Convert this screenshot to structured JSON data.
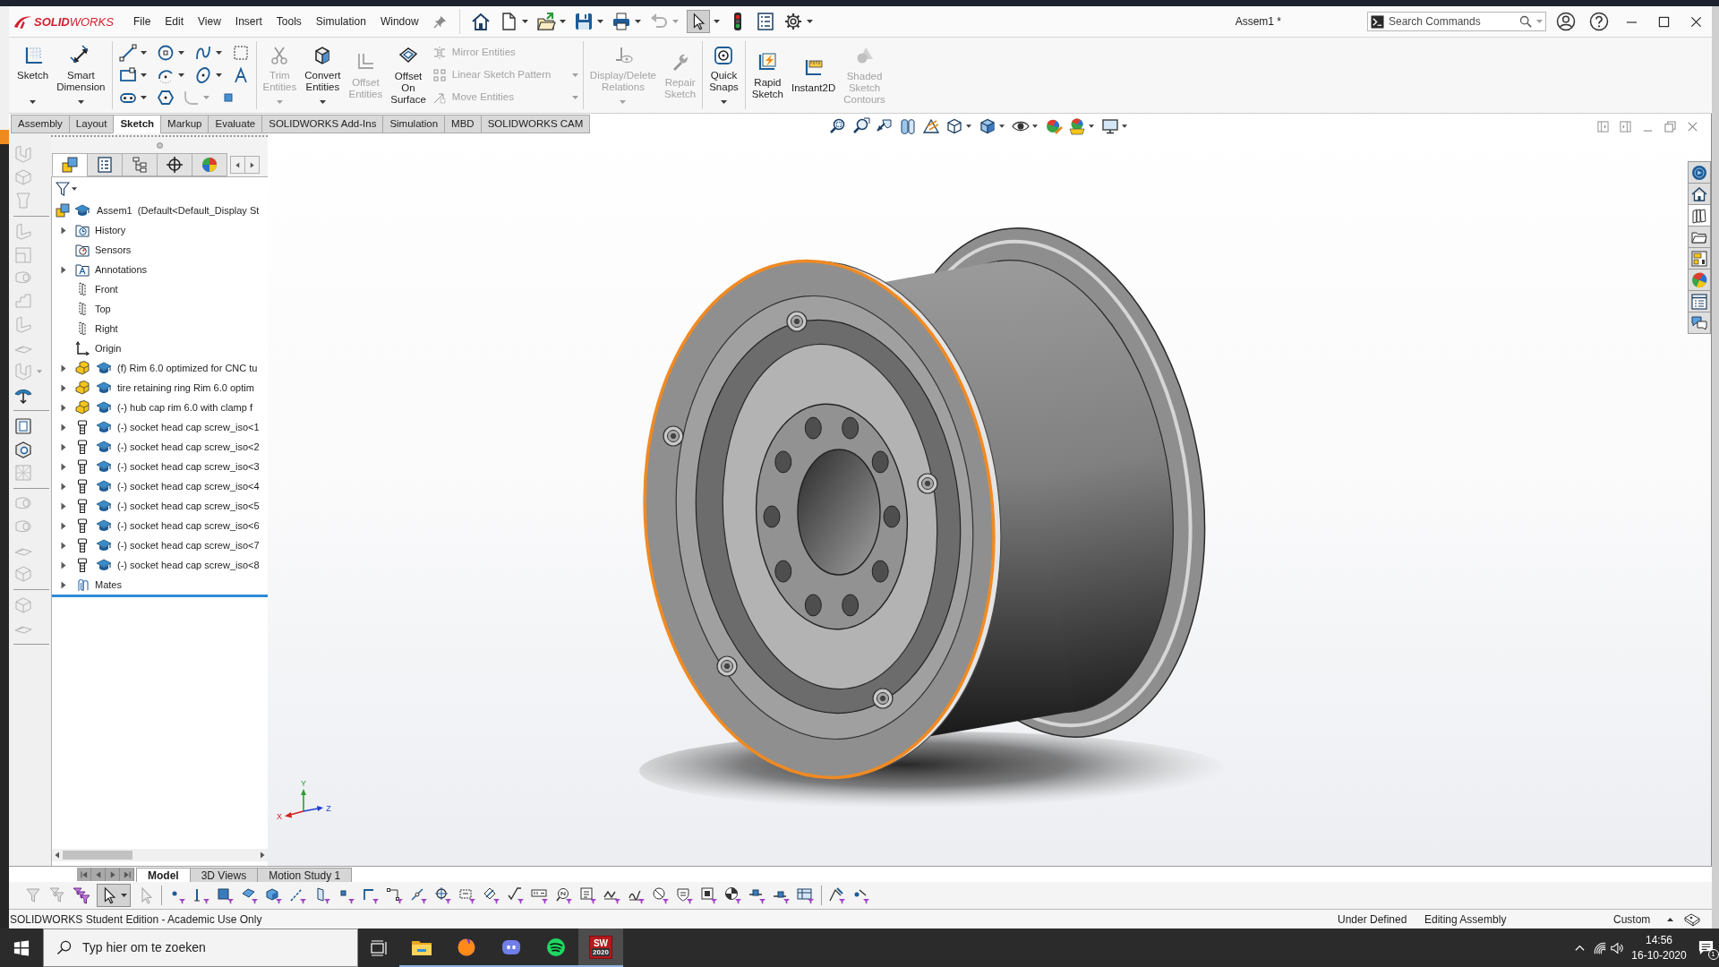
{
  "window": {
    "logo": "**SOLID**WORKS",
    "title": "Assem1 *"
  },
  "menu": [
    "File",
    "Edit",
    "View",
    "Insert",
    "Tools",
    "Simulation",
    "Window"
  ],
  "select_tool": {
    "selected": true
  },
  "search": {
    "placeholder": "Search Commands"
  },
  "ribbon": [
    [
      {
        "kind": "large",
        "label": "Sketch",
        "disabled": false,
        "dropdown": true
      },
      {
        "kind": "large",
        "label": "Smart\nDimension",
        "disabled": false,
        "dropdown": true
      }
    ],
    [
      {
        "kind": "tools"
      }
    ],
    [
      {
        "kind": "large",
        "label": "Trim\nEntities",
        "disabled": true,
        "dropdown": true
      },
      {
        "kind": "large",
        "label": "Convert\nEntities",
        "disabled": false,
        "dropdown": true
      },
      {
        "kind": "large",
        "label": "Offset\nEntities",
        "disabled": true,
        "dropdown": false
      },
      {
        "kind": "large",
        "label": "Offset\nOn\nSurface",
        "disabled": false,
        "dropdown": false
      },
      {
        "kind": "stack",
        "rows": [
          {
            "label": "Mirror Entities",
            "disabled": true,
            "dropdown": false
          },
          {
            "label": "Linear Sketch Pattern",
            "disabled": true,
            "dropdown": true
          },
          {
            "label": "Move Entities",
            "disabled": true,
            "dropdown": true
          }
        ]
      }
    ],
    [
      {
        "kind": "large",
        "label": "Display/Delete\nRelations",
        "disabled": true,
        "dropdown": true
      },
      {
        "kind": "large",
        "label": "Repair\nSketch",
        "disabled": true,
        "dropdown": false
      }
    ],
    [
      {
        "kind": "large",
        "label": "Quick\nSnaps",
        "disabled": false,
        "dropdown": true
      }
    ],
    [
      {
        "kind": "large",
        "label": "Rapid\nSketch",
        "disabled": false,
        "dropdown": false
      },
      {
        "kind": "large",
        "label": "Instant2D",
        "disabled": false,
        "dropdown": false
      },
      {
        "kind": "large",
        "label": "Shaded\nSketch\nContours",
        "disabled": true,
        "dropdown": false
      }
    ]
  ],
  "command_tabs": [
    {
      "label": "Assembly",
      "selected": false
    },
    {
      "label": "Layout",
      "selected": false
    },
    {
      "label": "Sketch",
      "selected": true
    },
    {
      "label": "Markup",
      "selected": false
    },
    {
      "label": "Evaluate",
      "selected": false
    },
    {
      "label": "SOLIDWORKS Add-Ins",
      "selected": false
    },
    {
      "label": "Simulation",
      "selected": false
    },
    {
      "label": "MBD",
      "selected": false
    },
    {
      "label": "SOLIDWORKS CAM",
      "selected": false
    }
  ],
  "feature_manager": {
    "tabs": [
      {
        "kind": "tree",
        "selected": true
      },
      {
        "kind": "properties",
        "selected": false
      },
      {
        "kind": "configurations",
        "selected": false
      },
      {
        "kind": "dimxpert",
        "selected": false
      },
      {
        "kind": "display",
        "selected": false
      }
    ],
    "tree": {
      "kind": "assembly",
      "label": "Assem1  (Default<Default_Display St",
      "children": [
        {
          "kind": "history",
          "label": "History",
          "expandable": true,
          "expanded": false
        },
        {
          "kind": "sensors",
          "label": "Sensors",
          "expandable": false,
          "expanded": false
        },
        {
          "kind": "annotations",
          "label": "Annotations",
          "expandable": true,
          "expanded": false
        },
        {
          "kind": "plane",
          "label": "Front",
          "expandable": false,
          "expanded": false
        },
        {
          "kind": "plane",
          "label": "Top",
          "expandable": false,
          "expanded": false
        },
        {
          "kind": "plane",
          "label": "Right",
          "expandable": false,
          "expanded": false
        },
        {
          "kind": "origin",
          "label": "Origin",
          "expandable": false,
          "expanded": false
        },
        {
          "kind": "part",
          "label": "(f) Rim 6.0 optimized for CNC tu",
          "expandable": true,
          "expanded": false
        },
        {
          "kind": "part",
          "label": "tire retaining ring Rim 6.0 optim",
          "expandable": true,
          "expanded": false
        },
        {
          "kind": "part",
          "label": "(-) hub cap rim 6.0 with clamp f",
          "expandable": true,
          "expanded": false
        },
        {
          "kind": "screw",
          "label": "(-) socket head cap screw_iso<1",
          "expandable": true,
          "expanded": false
        },
        {
          "kind": "screw",
          "label": "(-) socket head cap screw_iso<2",
          "expandable": true,
          "expanded": false
        },
        {
          "kind": "screw",
          "label": "(-) socket head cap screw_iso<3",
          "expandable": true,
          "expanded": false
        },
        {
          "kind": "screw",
          "label": "(-) socket head cap screw_iso<4",
          "expandable": true,
          "expanded": false
        },
        {
          "kind": "screw",
          "label": "(-) socket head cap screw_iso<5",
          "expandable": true,
          "expanded": false
        },
        {
          "kind": "screw",
          "label": "(-) socket head cap screw_iso<6",
          "expandable": true,
          "expanded": false
        },
        {
          "kind": "screw",
          "label": "(-) socket head cap screw_iso<7",
          "expandable": true,
          "expanded": false
        },
        {
          "kind": "screw",
          "label": "(-) socket head cap screw_iso<8",
          "expandable": true,
          "expanded": false
        },
        {
          "kind": "mates",
          "label": "Mates",
          "expandable": true,
          "expanded": false
        }
      ]
    }
  },
  "viewport": {
    "rim_selected": true,
    "triad": {
      "x": "X",
      "y": "Y",
      "z": "Z"
    }
  },
  "task_pane": [
    {
      "kind": "resources",
      "selected": false
    },
    {
      "kind": "home",
      "selected": false
    },
    {
      "kind": "library",
      "selected": true
    },
    {
      "kind": "files",
      "selected": false
    },
    {
      "kind": "views",
      "selected": false
    },
    {
      "kind": "appearances",
      "selected": false
    },
    {
      "kind": "properties",
      "selected": false
    },
    {
      "kind": "forum",
      "selected": false
    }
  ],
  "model_tabs": [
    {
      "label": "Model",
      "selected": true
    },
    {
      "label": "3D Views",
      "selected": false
    },
    {
      "label": "Motion Study 1",
      "selected": false
    }
  ],
  "filter_select_tool": {
    "selected": true
  },
  "status_bar": {
    "message": "SOLIDWORKS Student Edition - Academic Use Only",
    "sketch_status": "Under Defined",
    "mode": "Editing Assembly",
    "units": "Custom"
  },
  "taskbar": {
    "search_placeholder": "Typ hier om te zoeken",
    "apps": [
      {
        "kind": "explorer",
        "running": true,
        "selected": false
      },
      {
        "kind": "firefox",
        "running": true,
        "selected": false
      },
      {
        "kind": "discord",
        "running": true,
        "selected": false
      },
      {
        "kind": "spotify",
        "running": true,
        "selected": false
      },
      {
        "kind": "solidworks",
        "running": true,
        "selected": true,
        "label": "SW",
        "badge": "2020"
      }
    ],
    "time": "14:56",
    "date": "16-10-2020",
    "notifications": "1"
  }
}
